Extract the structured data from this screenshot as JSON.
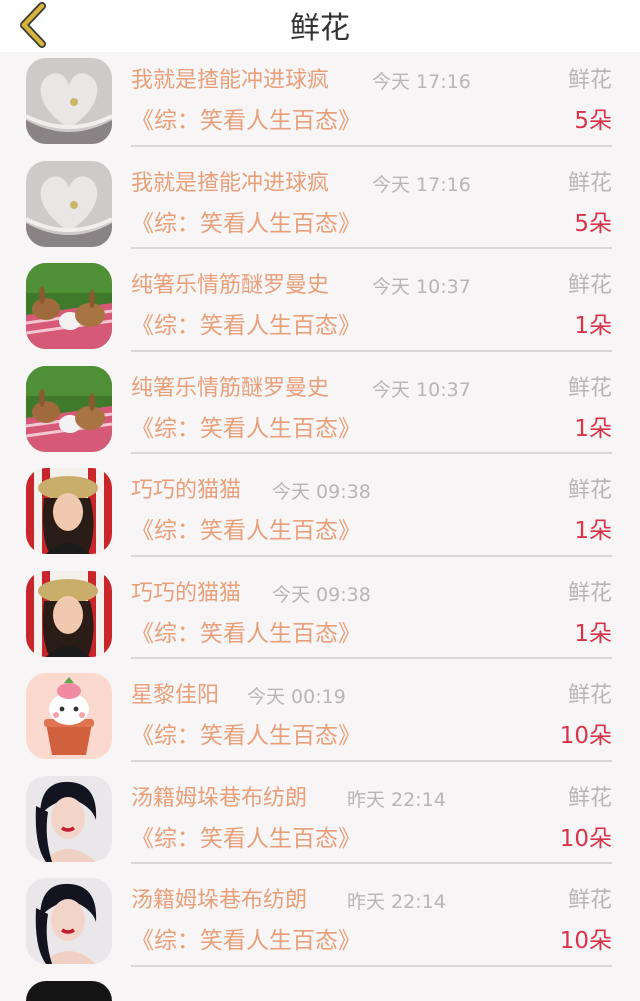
{
  "header": {
    "title": "鲜花",
    "back_icon": "chevron-left-icon",
    "accent_color": "#c9a227"
  },
  "colors": {
    "name": "#e8a07a",
    "time": "#b9b5b7",
    "count": "#d9334a"
  },
  "list": {
    "items": [
      {
        "name": "我就是揸能冲进球疯",
        "time": "今天 17:16",
        "gift": "鲜花",
        "book": "《综：笑看人生百态》",
        "count": "5朵",
        "avatar": "heart-book-avatar"
      },
      {
        "name": "我就是揸能冲进球疯",
        "time": "今天 17:16",
        "gift": "鲜花",
        "book": "《综：笑看人生百态》",
        "count": "5朵",
        "avatar": "heart-book-avatar"
      },
      {
        "name": "纯箸乐情筋醚罗曼史",
        "time": "今天 10:37",
        "gift": "鲜花",
        "book": "《综：笑看人生百态》",
        "count": "1朵",
        "avatar": "rabbits-avatar"
      },
      {
        "name": "纯箸乐情筋醚罗曼史",
        "time": "今天 10:37",
        "gift": "鲜花",
        "book": "《综：笑看人生百态》",
        "count": "1朵",
        "avatar": "rabbits-avatar"
      },
      {
        "name": "巧巧的猫猫",
        "time": "今天 09:38",
        "gift": "鲜花",
        "book": "《综：笑看人生百态》",
        "count": "1朵",
        "avatar": "girl-hat-avatar"
      },
      {
        "name": "巧巧的猫猫",
        "time": "今天 09:38",
        "gift": "鲜花",
        "book": "《综：笑看人生百态》",
        "count": "1朵",
        "avatar": "girl-hat-avatar"
      },
      {
        "name": "星黎佳阳",
        "time": "今天 00:19",
        "gift": "鲜花",
        "book": "《综：笑看人生百态》",
        "count": "10朵",
        "avatar": "cartoon-pot-avatar"
      },
      {
        "name": "汤籍姆垛巷布纺朗",
        "time": "昨天 22:14",
        "gift": "鲜花",
        "book": "《综：笑看人生百态》",
        "count": "10朵",
        "avatar": "woman-portrait-avatar"
      },
      {
        "name": "汤籍姆垛巷布纺朗",
        "time": "昨天 22:14",
        "gift": "鲜花",
        "book": "《综：笑看人生百态》",
        "count": "10朵",
        "avatar": "woman-portrait-avatar"
      }
    ]
  }
}
